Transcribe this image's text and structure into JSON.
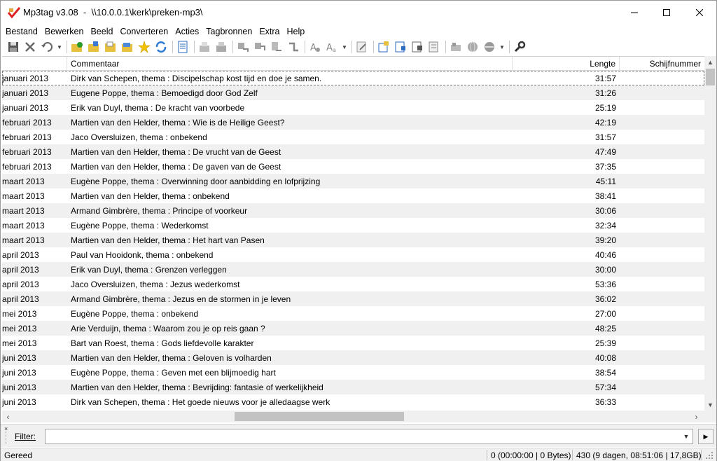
{
  "window": {
    "app_name": "Mp3tag v3.08",
    "path": "\\\\10.0.0.1\\kerk\\preken-mp3\\",
    "title_full": "Mp3tag v3.08  -  \\\\10.0.0.1\\kerk\\preken-mp3\\"
  },
  "menu": [
    "Bestand",
    "Bewerken",
    "Beeld",
    "Converteren",
    "Acties",
    "Tagbronnen",
    "Extra",
    "Help"
  ],
  "toolbar_icons": [
    "save-icon",
    "remove-tag-icon",
    "undo-icon",
    "change-directory-icon",
    "add-directory-icon",
    "open-folder-icon",
    "favorite-folder-icon",
    "favorite-star-icon",
    "refresh-icon",
    "playlist-icon",
    "copy-tag-icon",
    "paste-tag-icon",
    "tag-to-filename-icon",
    "filename-to-tag-icon",
    "text-to-tag-icon",
    "tag-to-tag-icon",
    "autonumber-icon",
    "case-conversion-icon",
    "extended-tags-icon",
    "export-icon",
    "import-icon",
    "tag-source-icon",
    "web-source-icon",
    "freedb-icon",
    "settings-wrench-icon"
  ],
  "columns": {
    "date": "",
    "comment": "Commentaar",
    "length": "Lengte",
    "disk": "Schijfnummer"
  },
  "rows": [
    {
      "date": "januari 2013",
      "comment": "Dirk van Schepen, thema : Discipelschap kost tijd en doe je samen.",
      "length": "31:57"
    },
    {
      "date": "januari 2013",
      "comment": "Eugene Poppe, thema : Bemoedigd door God Zelf",
      "length": "31:26"
    },
    {
      "date": "januari 2013",
      "comment": "Erik van Duyl, thema : De kracht van voorbede",
      "length": "25:19"
    },
    {
      "date": "februari 2013",
      "comment": "Martien van den Helder, thema : Wie is de Heilige Geest?",
      "length": "42:19"
    },
    {
      "date": "februari 2013",
      "comment": "Jaco Oversluizen, thema : onbekend",
      "length": "31:57"
    },
    {
      "date": "februari 2013",
      "comment": "Martien van den Helder, thema : De vrucht van de Geest",
      "length": "47:49"
    },
    {
      "date": "februari 2013",
      "comment": "Martien van den Helder, thema : De gaven van de Geest",
      "length": "37:35"
    },
    {
      "date": "maart 2013",
      "comment": "Eugène Poppe, thema : Overwinning door aanbidding en lofprijzing",
      "length": "45:11"
    },
    {
      "date": "maart 2013",
      "comment": "Martien van den Helder, thema : onbekend",
      "length": "38:41"
    },
    {
      "date": "maart 2013",
      "comment": "Armand Gimbrère, thema : Principe of voorkeur",
      "length": "30:06"
    },
    {
      "date": "maart 2013",
      "comment": "Eugène Poppe, thema : Wederkomst",
      "length": "32:34"
    },
    {
      "date": "maart 2013",
      "comment": "Martien van den Helder, thema : Het hart van Pasen",
      "length": "39:20"
    },
    {
      "date": "april 2013",
      "comment": "Paul van Hooidonk, thema : onbekend",
      "length": "40:46"
    },
    {
      "date": "april 2013",
      "comment": "Erik van Duyl, thema : Grenzen verleggen",
      "length": "30:00"
    },
    {
      "date": "april 2013",
      "comment": "Jaco Oversluizen, thema : Jezus wederkomst",
      "length": "53:36"
    },
    {
      "date": "april 2013",
      "comment": "Armand Gimbrère, thema : Jezus en de stormen in je leven",
      "length": "36:02"
    },
    {
      "date": "mei 2013",
      "comment": "Eugène Poppe, thema : onbekend",
      "length": "27:00"
    },
    {
      "date": "mei 2013",
      "comment": "Arie Verduijn, thema : Waarom zou je op reis gaan ?",
      "length": "48:25"
    },
    {
      "date": "mei 2013",
      "comment": "Bart van Roest, thema : Gods liefdevolle karakter",
      "length": "25:39"
    },
    {
      "date": "juni 2013",
      "comment": "Martien van den Helder, thema : Geloven is volharden",
      "length": "40:08"
    },
    {
      "date": "juni 2013",
      "comment": "Eugène Poppe, thema : Geven met een blijmoedig hart",
      "length": "38:54"
    },
    {
      "date": "juni 2013",
      "comment": "Martien van den Helder, thema : Bevrijding: fantasie of werkelijkheid",
      "length": "57:34"
    },
    {
      "date": "juni 2013",
      "comment": "Dirk van Schepen, thema : Het goede nieuws voor je alledaagse werk",
      "length": "36:33"
    }
  ],
  "filter": {
    "label": "Filter:",
    "value": ""
  },
  "status": {
    "left": "Gereed",
    "selection": "0 (00:00:00 | 0 Bytes)",
    "total": "430 (9 dagen, 08:51:06 | 17,8GB)"
  },
  "colors": {
    "row_alt": "#f0f0f0",
    "chrome": "#f0f0f0",
    "scroll_thumb": "#c2c2c2"
  }
}
